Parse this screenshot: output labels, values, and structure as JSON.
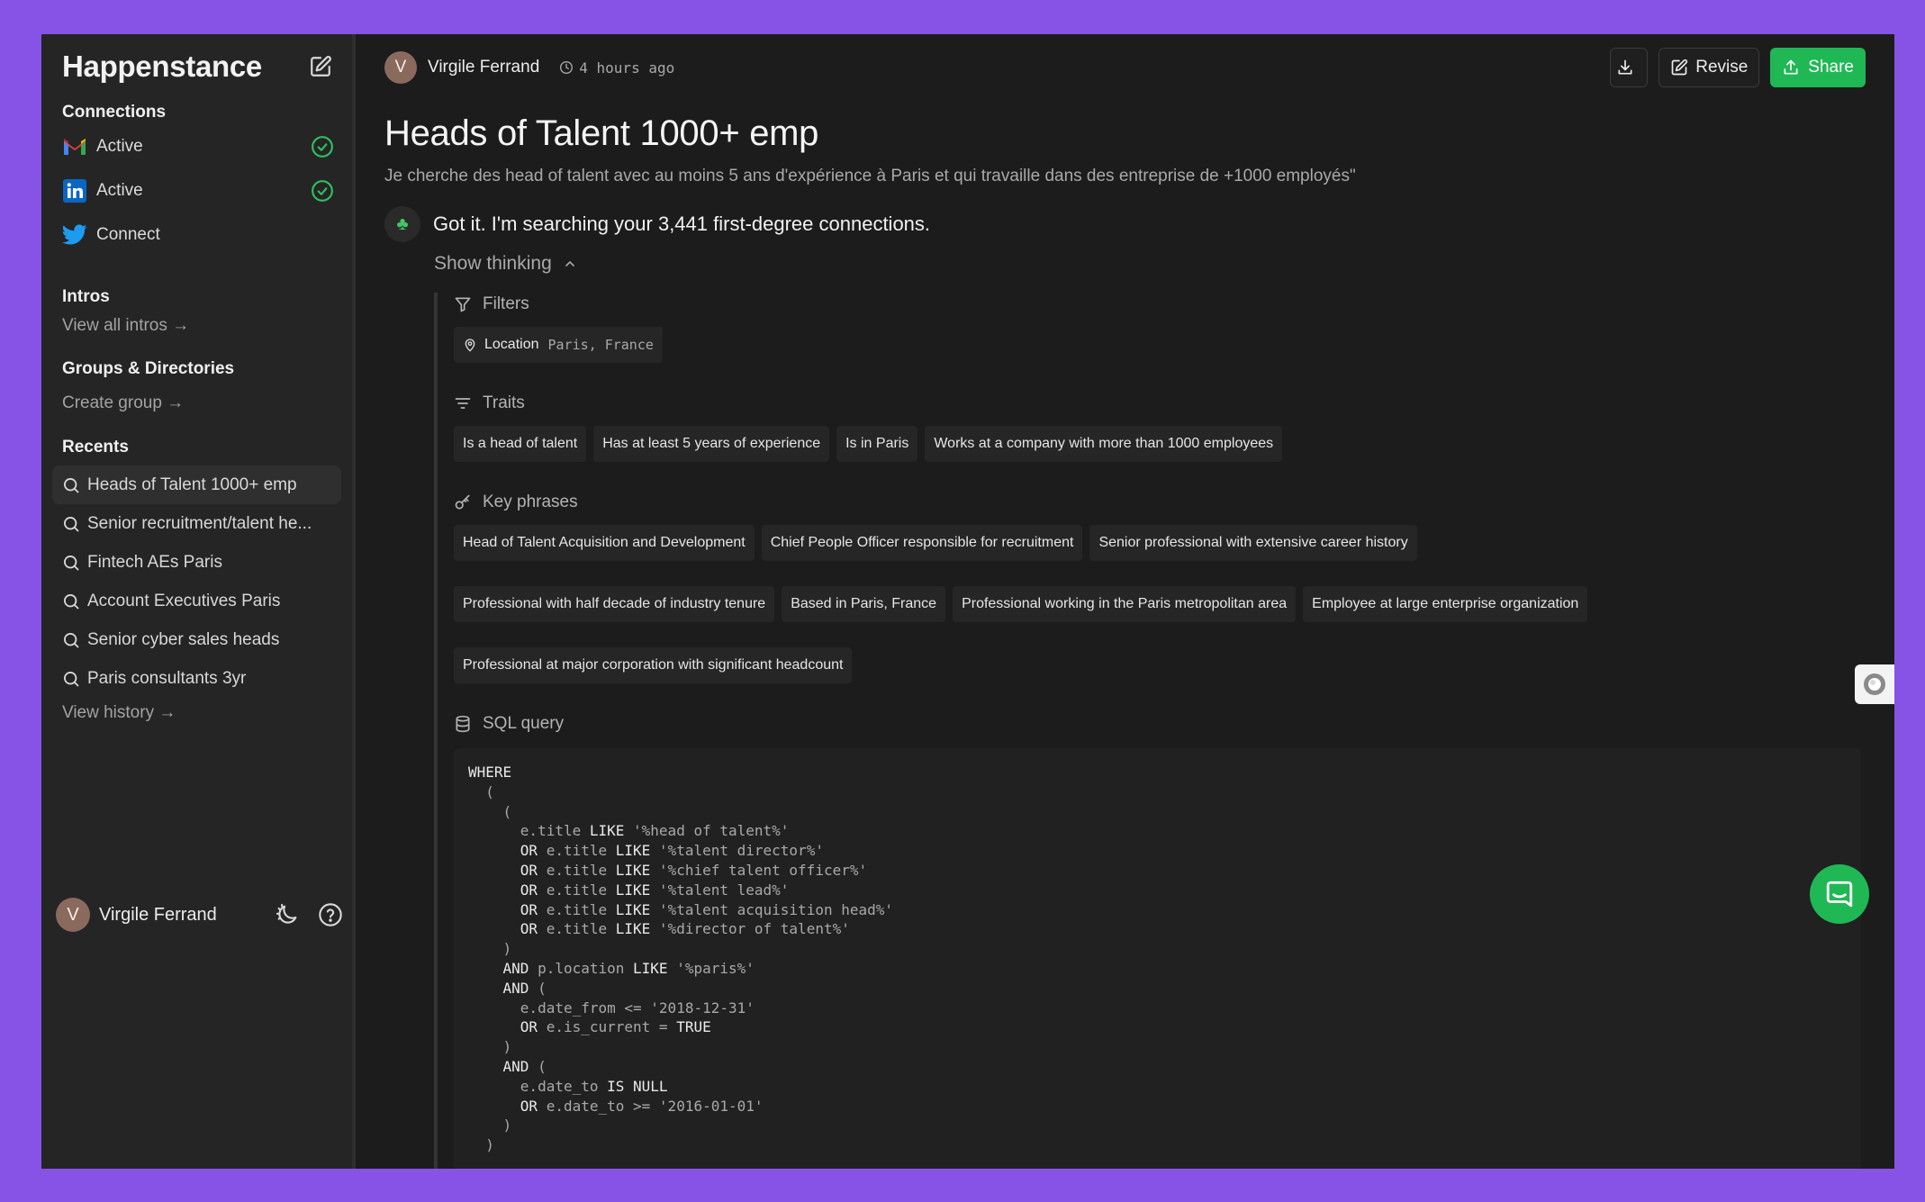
{
  "app": {
    "name": "Happenstance"
  },
  "sidebar": {
    "connections_title": "Connections",
    "connections": [
      {
        "service": "gmail",
        "label": "Active",
        "status": "active"
      },
      {
        "service": "linkedin",
        "label": "Active",
        "status": "active"
      },
      {
        "service": "twitter",
        "label": "Connect",
        "status": "none"
      }
    ],
    "intros_title": "Intros",
    "view_all_intros": "View all intros →",
    "groups_title": "Groups & Directories",
    "create_group": "Create group →",
    "recents_title": "Recents",
    "recents": [
      "Heads of Talent 1000+ emp",
      "Senior recruitment/talent he...",
      "Fintech AEs Paris",
      "Account Executives Paris",
      "Senior cyber sales heads",
      "Paris consultants 3yr"
    ],
    "view_history": "View history →",
    "user": {
      "initial": "V",
      "name": "Virgile Ferrand"
    }
  },
  "main": {
    "author_initial": "V",
    "author": "Virgile Ferrand",
    "time": "4 hours ago",
    "actions": {
      "revise": "Revise",
      "share": "Share"
    },
    "title": "Heads of Talent 1000+ emp",
    "query": "Je cherche des head of talent avec au moins 5 ans d'expérience à Paris et qui travaille dans des entreprise de +1000 employés\"",
    "assistant_text": "Got it. I'm searching your 3,441 first-degree connections.",
    "show_thinking": "Show thinking",
    "filters_title": "Filters",
    "filters": [
      {
        "key": "Location",
        "value": "Paris, France"
      }
    ],
    "traits_title": "Traits",
    "traits": [
      "Is a head of talent",
      "Has at least 5 years of experience",
      "Is in Paris",
      "Works at a company with more than 1000 employees"
    ],
    "key_phrases_title": "Key phrases",
    "key_phrases": [
      "Head of Talent Acquisition and Development",
      "Chief People Officer responsible for recruitment",
      "Senior professional with extensive career history",
      "Professional with half decade of industry tenure",
      "Based in Paris, France",
      "Professional working in the Paris metropolitan area",
      "Employee at large enterprise organization",
      "Professional at major corporation with significant headcount"
    ],
    "sql_title": "SQL query",
    "sql_lines": [
      "WHERE",
      "  (",
      "    (",
      "      e.title LIKE '%head of talent%'",
      "      OR e.title LIKE '%talent director%'",
      "      OR e.title LIKE '%chief talent officer%'",
      "      OR e.title LIKE '%talent lead%'",
      "      OR e.title LIKE '%talent acquisition head%'",
      "      OR e.title LIKE '%director of talent%'",
      "    )",
      "    AND p.location LIKE '%paris%'",
      "    AND (",
      "      e.date_from <= '2018-12-31'",
      "      OR e.is_current = TRUE",
      "    )",
      "    AND (",
      "      e.date_to IS NULL",
      "      OR e.date_to >= '2016-01-01'",
      "    )",
      "  )"
    ]
  },
  "colors": {
    "background": "#8752e6",
    "accent": "#1fb855",
    "panel": "#1c1c1c",
    "sidebar": "#252525"
  }
}
